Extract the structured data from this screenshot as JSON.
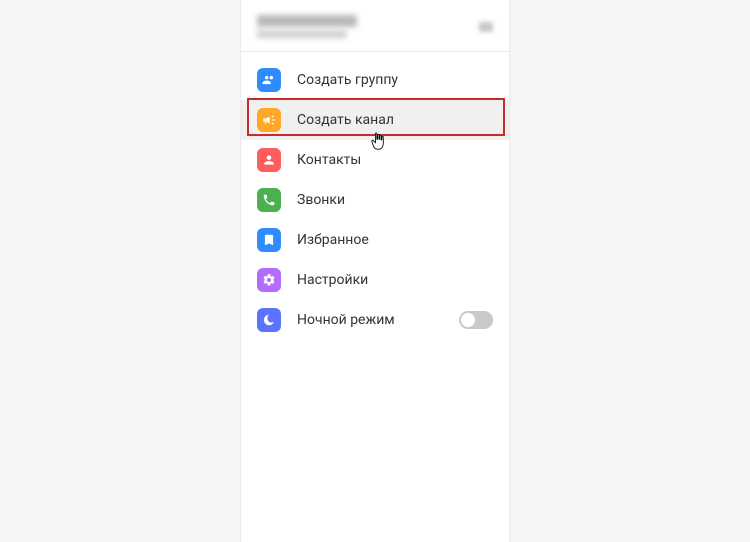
{
  "colors": {
    "blue": "#2f8cff",
    "orange": "#ffa726",
    "red": "#ff5c5c",
    "green": "#4caf50",
    "blue2": "#2f8cff",
    "purple": "#b46cff",
    "indigo": "#5c73ff"
  },
  "menu": {
    "create_group": "Создать группу",
    "create_channel": "Создать канал",
    "contacts": "Контакты",
    "calls": "Звонки",
    "favorites": "Избранное",
    "settings": "Настройки",
    "night_mode": "Ночной режим"
  },
  "night_mode_on": false
}
